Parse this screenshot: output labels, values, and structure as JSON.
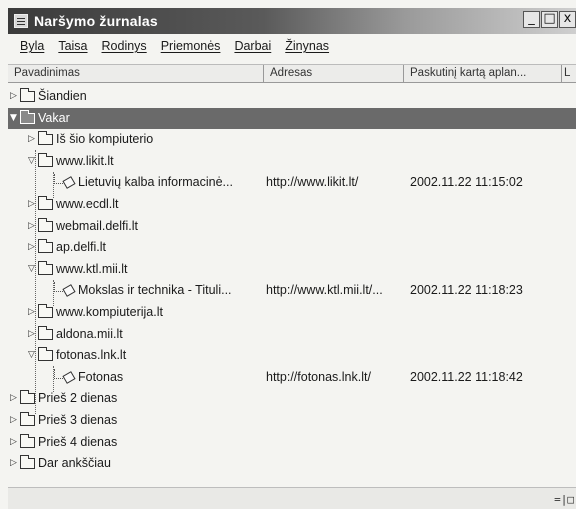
{
  "window": {
    "title": "Naršymo žurnalas",
    "controls": {
      "minimize": "_",
      "maximize": "□",
      "close": "x"
    }
  },
  "menu": [
    "Byla",
    "Taisa",
    "Rodinys",
    "Priemonės",
    "Darbai",
    "Žinynas"
  ],
  "columns": [
    "Pavadinimas",
    "Adresas",
    "Paskutinį kartą aplan...",
    "L"
  ],
  "tree": [
    {
      "type": "folder",
      "label": "Šiandien",
      "expander": "▷"
    },
    {
      "type": "folder",
      "label": "Vakar",
      "expander": "▼",
      "selected": true
    },
    {
      "type": "folder",
      "label": "Iš šio kompiuterio",
      "expander": "▷"
    },
    {
      "type": "folder",
      "label": "www.likit.lt",
      "expander": "▽",
      "open": true
    },
    {
      "type": "page",
      "label": "Lietuvių kalba informacinė...",
      "address": "http://www.likit.lt/",
      "timestamp": "2002.11.22 11:15:02"
    },
    {
      "type": "folder",
      "label": "www.ecdl.lt",
      "expander": "▷"
    },
    {
      "type": "folder",
      "label": "webmail.delfi.lt",
      "expander": "▷"
    },
    {
      "type": "folder",
      "label": "ap.delfi.lt",
      "expander": "▷"
    },
    {
      "type": "folder",
      "label": "www.ktl.mii.lt",
      "expander": "▽",
      "open": true
    },
    {
      "type": "page",
      "label": "Mokslas ir technika - Tituli...",
      "address": "http://www.ktl.mii.lt/...",
      "timestamp": "2002.11.22 11:18:23"
    },
    {
      "type": "folder",
      "label": "www.kompiuterija.lt",
      "expander": "▷"
    },
    {
      "type": "folder",
      "label": "aldona.mii.lt",
      "expander": "▷"
    },
    {
      "type": "folder",
      "label": "fotonas.lnk.lt",
      "expander": "▽",
      "open": true
    },
    {
      "type": "page",
      "label": "Fotonas",
      "address": "http://fotonas.lnk.lt/",
      "timestamp": "2002.11.22 11:18:42"
    },
    {
      "type": "folder",
      "label": "Prieš 2 dienas",
      "expander": "▷"
    },
    {
      "type": "folder",
      "label": "Prieš 3 dienas",
      "expander": "▷"
    },
    {
      "type": "folder",
      "label": "Prieš 4 dienas",
      "expander": "▷"
    },
    {
      "type": "folder",
      "label": "Dar ankščiau",
      "expander": "▷"
    }
  ],
  "icons": {
    "app": "history-list-icon",
    "folder": "folder-icon",
    "page": "page-icon",
    "collapsed": "expander-collapsed-icon",
    "expanded": "expander-expanded-icon"
  },
  "colors": {
    "titlebar_dark": "#3b3b3b",
    "selection": "#6a6a6a",
    "background": "#f4f4f1"
  }
}
